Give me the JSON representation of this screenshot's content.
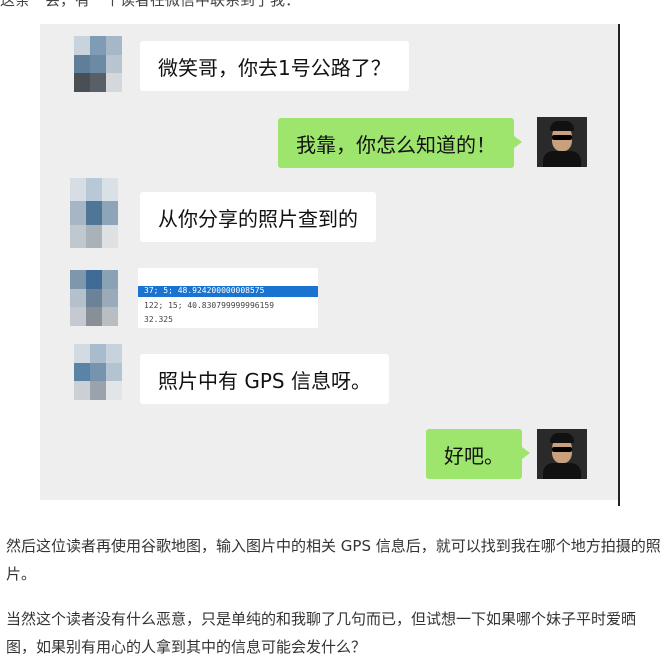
{
  "article": {
    "top_partial": "这条一会，有一个读者在微信中联系到了我：",
    "paragraph1": "然后这位读者再使用谷歌地图，输入图片中的相关 GPS 信息后，就可以找到我在哪个地方拍摄的照片。",
    "paragraph2": "当然这个读者没有什么恶意，只是单纯的和我聊了几句而已，但试想一下如果哪个妹子平时爱晒图，如果别有用心的人拿到其中的信息可能会发什么？"
  },
  "chat": {
    "messages": [
      {
        "side": "left",
        "text": "微笑哥，你去1号公路了？"
      },
      {
        "side": "right",
        "text": "我靠，你怎么知道的！"
      },
      {
        "side": "left",
        "text": "从你分享的照片查到的"
      },
      {
        "side": "left",
        "type": "image",
        "lines": [
          "37; 5; 48.924200000008575",
          "122; 15; 40.830799999996159",
          "32.325"
        ]
      },
      {
        "side": "left",
        "text": "照片中有 GPS 信息呀。"
      },
      {
        "side": "right",
        "text": "好吧。"
      }
    ]
  },
  "colors": {
    "chat_background": "#eeeeee",
    "sent_bubble": "#9de56c",
    "received_bubble": "#ffffff",
    "selection": "#1b73d0"
  }
}
